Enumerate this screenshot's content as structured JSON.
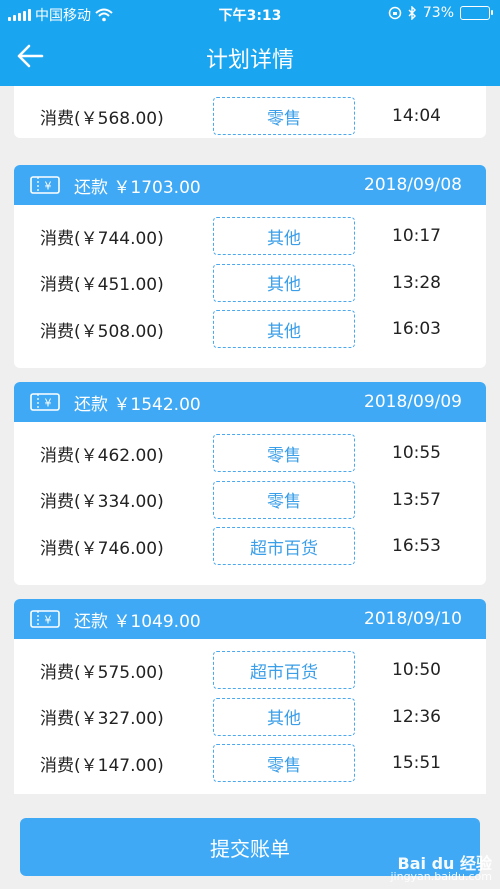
{
  "status_bar": {
    "carrier": "中国移动",
    "time": "下午3:13",
    "battery_percent": "73%",
    "battery_level": 0.73
  },
  "header": {
    "title": "计划详情"
  },
  "partial_row": {
    "amount": "消费(￥568.00)",
    "category": "零售",
    "time": "14:04"
  },
  "plans": [
    {
      "repay": "还款 ￥1703.00",
      "date": "2018/09/08",
      "rows": [
        {
          "amount": "消费(￥744.00)",
          "category": "其他",
          "time": "10:17"
        },
        {
          "amount": "消费(￥451.00)",
          "category": "其他",
          "time": "13:28"
        },
        {
          "amount": "消费(￥508.00)",
          "category": "其他",
          "time": "16:03"
        }
      ]
    },
    {
      "repay": "还款 ￥1542.00",
      "date": "2018/09/09",
      "rows": [
        {
          "amount": "消费(￥462.00)",
          "category": "零售",
          "time": "10:55"
        },
        {
          "amount": "消费(￥334.00)",
          "category": "零售",
          "time": "13:57"
        },
        {
          "amount": "消费(￥746.00)",
          "category": "超市百货",
          "time": "16:53"
        }
      ]
    },
    {
      "repay": "还款 ￥1049.00",
      "date": "2018/09/10",
      "rows": [
        {
          "amount": "消费(￥575.00)",
          "category": "超市百货",
          "time": "10:50"
        },
        {
          "amount": "消费(￥327.00)",
          "category": "其他",
          "time": "12:36"
        },
        {
          "amount": "消费(￥147.00)",
          "category": "零售",
          "time": "15:51"
        }
      ]
    }
  ],
  "submit_label": "提交账单",
  "watermark": {
    "brand": "Bai du 经验",
    "url": "jingyan.baidu.com"
  },
  "colors": {
    "primary": "#1aa5f0",
    "card_header": "#3fa9f5",
    "tag_border": "#49a8ee",
    "battery": "#f5c02c"
  }
}
